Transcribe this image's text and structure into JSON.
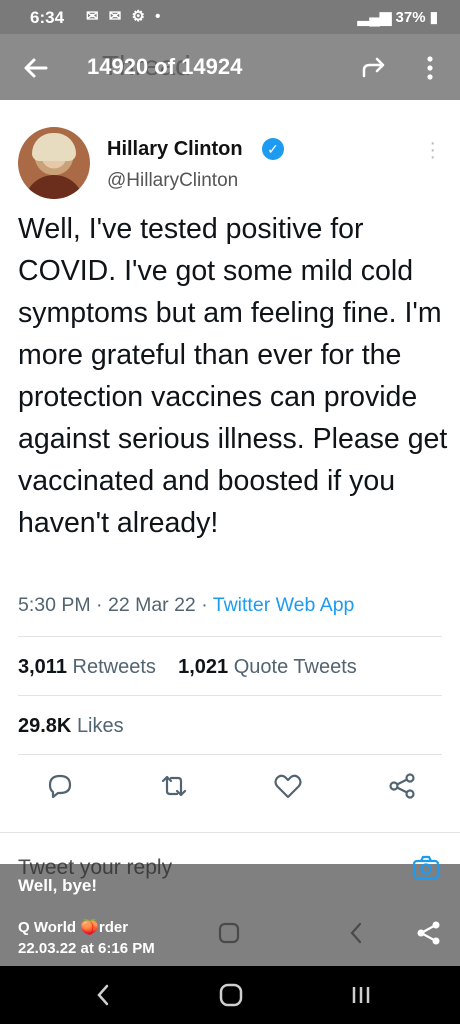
{
  "status_bar": {
    "time": "6:34",
    "notification_icons": "✉ ✉ ⚙ •",
    "battery": "37%"
  },
  "app_bar": {
    "title": "14920 of 14924",
    "ghost_title": "Thread"
  },
  "tweet": {
    "name": "Hillary Clinton",
    "handle": "@HillaryClinton",
    "body": "Well, I've tested positive for COVID. I've got some mild cold symptoms but am feeling fine. I'm more grateful than ever for the protection vaccines can provide against serious illness. Please get vaccinated and boosted if you haven't already!",
    "time": "5:30 PM",
    "date": "22 Mar 22",
    "source": "Twitter Web App",
    "retweets": "3,011",
    "retweets_label": "Retweets",
    "quote_tweets": "1,021",
    "quote_tweets_label": "Quote Tweets",
    "likes": "29.8K",
    "likes_label": "Likes"
  },
  "reply": {
    "placeholder": "Tweet your reply"
  },
  "overlay": {
    "caption": "Well, bye!",
    "source_name": "Q World 🍑rder",
    "timestamp": "22.03.22 at 6:16 PM"
  },
  "colors": {
    "twitter_blue": "#1d9bf0",
    "appbar_gray": "#8b8b8b"
  }
}
